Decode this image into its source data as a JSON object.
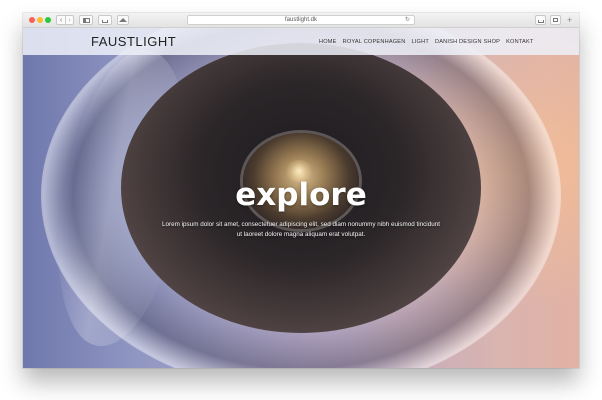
{
  "browser": {
    "url": "faustlight.dk",
    "back_glyph": "‹",
    "forward_glyph": "›",
    "reload_glyph": "↻",
    "new_tab_glyph": "+",
    "icons": [
      "back-icon",
      "forward-icon",
      "sidebar-icon",
      "share-icon",
      "home-icon",
      "reload-icon",
      "tabs-icon",
      "new-tab-icon"
    ]
  },
  "site": {
    "logo": "FAUSTLIGHT",
    "nav": [
      "HOME",
      "ROYAL COPENHAGEN",
      "LIGHT",
      "DANISH DESIGN SHOP",
      "KONTAKT"
    ]
  },
  "hero": {
    "heading": "explore",
    "text": "Lorem ipsum dolor sit amet, consectetuer adipiscing elit, sed diam nonummy nibh euismod tincidunt ut laoreet dolore magna aliquam erat volutpat."
  },
  "colors": {
    "traffic_red": "#fc5f57",
    "traffic_yellow": "#fdbc2e",
    "traffic_green": "#28c840",
    "navbar_bg": "#eef0f8",
    "heading": "#ffffff"
  }
}
